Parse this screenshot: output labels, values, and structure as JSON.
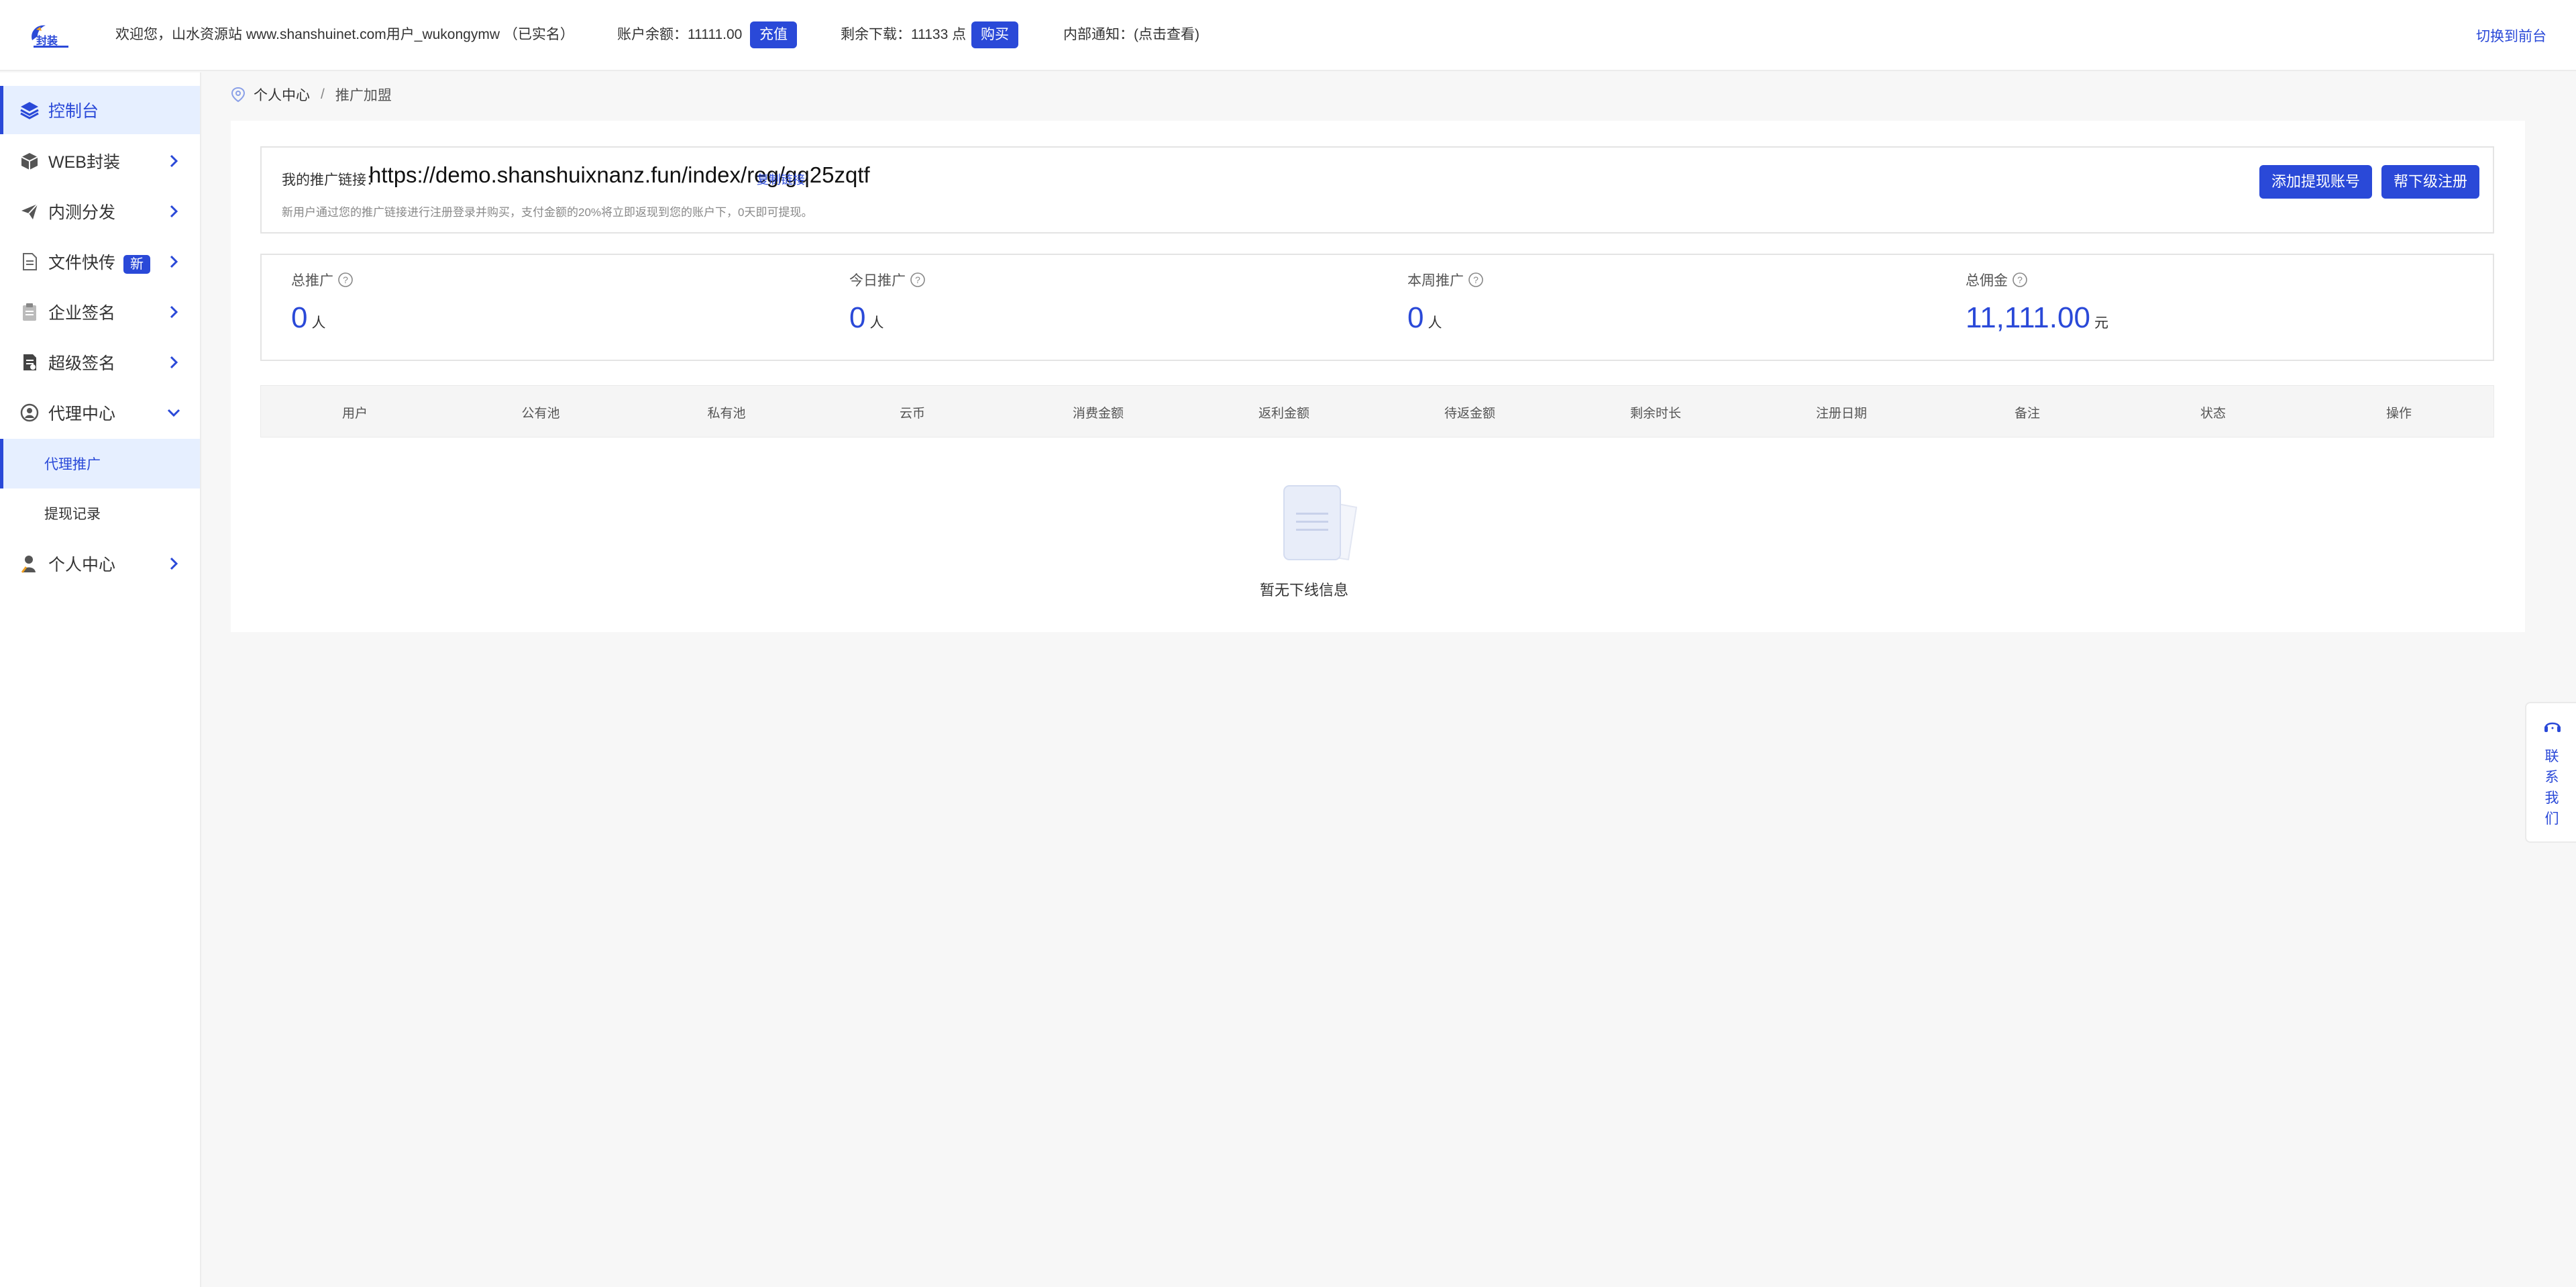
{
  "header": {
    "welcome": "欢迎您，山水资源站 www.shanshuinet.com用户_wukongymw （已实名）",
    "balance_label": "账户余额：11111.00",
    "recharge_btn": "充值",
    "downloads_label": "剩余下载：11133 点",
    "buy_btn": "购买",
    "notice": "内部通知：(点击查看)",
    "switch_front": "切换到前台"
  },
  "sidebar": {
    "items": [
      {
        "label": "控制台",
        "icon": "layers-icon"
      },
      {
        "label": "WEB封装",
        "icon": "box-icon"
      },
      {
        "label": "内测分发",
        "icon": "send-icon"
      },
      {
        "label": "文件快传",
        "icon": "file-icon",
        "badge": "新"
      },
      {
        "label": "企业签名",
        "icon": "clipboard-icon"
      },
      {
        "label": "超级签名",
        "icon": "document-icon"
      },
      {
        "label": "代理中心",
        "icon": "agent-icon"
      },
      {
        "label": "个人中心",
        "icon": "user-icon"
      }
    ],
    "subitems": [
      {
        "label": "代理推广"
      },
      {
        "label": "提现记录"
      }
    ]
  },
  "breadcrumb": {
    "root": "个人中心",
    "separator": "/",
    "current": "推广加盟"
  },
  "promo": {
    "label": "我的推广链接：",
    "url": "https://demo.shanshuixnanz.fun/index/reg/gq25zqtf",
    "copy": "复制链接",
    "desc": "新用户通过您的推广链接进行注册登录并购买，支付金额的20%将立即返现到您的账户下，0天即可提现。",
    "add_withdraw_btn": "添加提现账号",
    "help_register_btn": "帮下级注册"
  },
  "stats": [
    {
      "title": "总推广",
      "value": "0",
      "unit": "人"
    },
    {
      "title": "今日推广",
      "value": "0",
      "unit": "人"
    },
    {
      "title": "本周推广",
      "value": "0",
      "unit": "人"
    },
    {
      "title": "总佣金",
      "value": "11,111.00",
      "unit": "元"
    }
  ],
  "table": {
    "columns": [
      "用户",
      "公有池",
      "私有池",
      "云币",
      "消费金额",
      "返利金额",
      "待返金额",
      "剩余时长",
      "注册日期",
      "备注",
      "状态",
      "操作"
    ],
    "empty_text": "暂无下线信息"
  },
  "contact": {
    "text": [
      "联",
      "系",
      "我",
      "们"
    ]
  },
  "colors": {
    "accent": "#2a49d8",
    "active_bg": "#e6efff",
    "page_bg": "#f7f7f7"
  }
}
